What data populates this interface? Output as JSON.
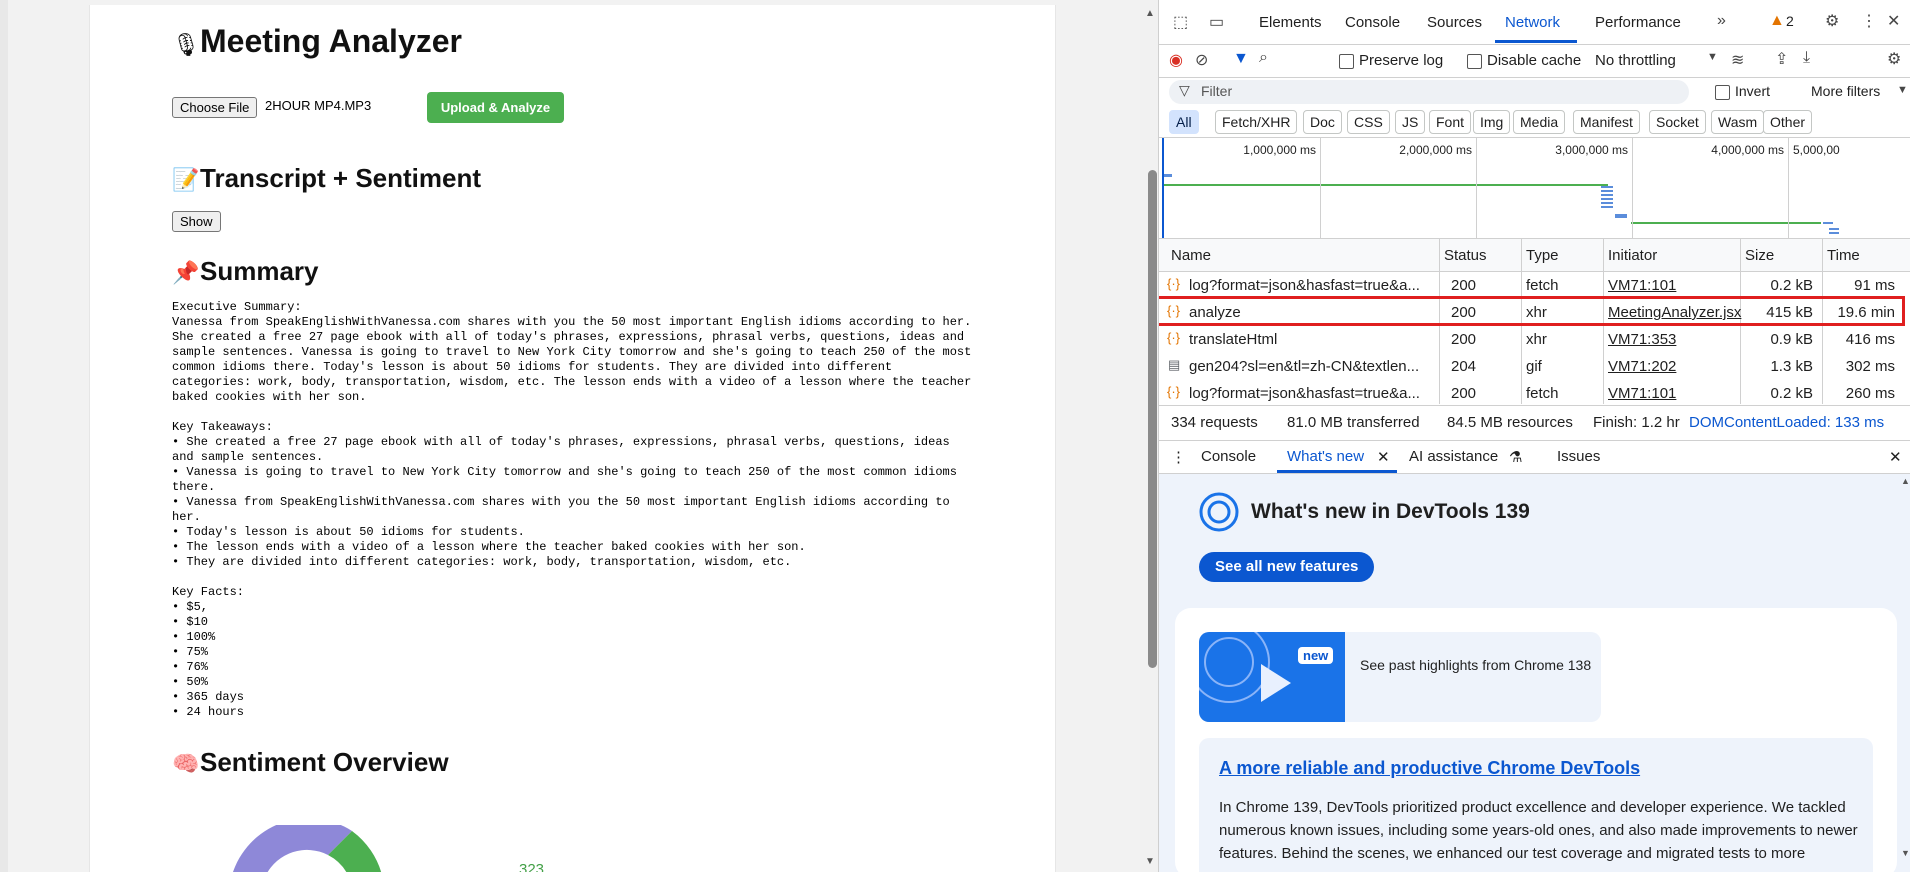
{
  "app": {
    "title": "Meeting Analyzer",
    "title_emoji": "🎙",
    "choose_file_label": "Choose File",
    "file_name": "2HOUR MP4.MP3",
    "upload_button": "Upload & Analyze",
    "transcript_heading": "Transcript + Sentiment",
    "transcript_emoji": "📝",
    "show_button": "Show",
    "summary_heading": "Summary",
    "summary_emoji": "📌",
    "summary_text": "Executive Summary:\nVanessa from SpeakEnglishWithVanessa.com shares with you the 50 most important English idioms according to her.\nShe created a free 27 page ebook with all of today's phrases, expressions, phrasal verbs, questions, ideas and\nsample sentences. Vanessa is going to travel to New York City tomorrow and she's going to teach 250 of the most\ncommon idioms there. Today's lesson is about 50 idioms for students. They are divided into different\ncategories: work, body, transportation, wisdom, etc. The lesson ends with a video of a lesson where the teacher\nbaked cookies with her son.\n\nKey Takeaways:\n• She created a free 27 page ebook with all of today's phrases, expressions, phrasal verbs, questions, ideas\nand sample sentences.\n• Vanessa is going to travel to New York City tomorrow and she's going to teach 250 of the most common idioms\nthere.\n• Vanessa from SpeakEnglishWithVanessa.com shares with you the 50 most important English idioms according to\nher.\n• Today's lesson is about 50 idioms for students.\n• The lesson ends with a video of a lesson where the teacher baked cookies with her son.\n• They are divided into different categories: work, body, transportation, wisdom, etc.\n\nKey Facts:\n• $5,\n• $10\n• 100%\n• 75%\n• 76%\n• 50%\n• 365 days\n• 24 hours",
    "sentiment_heading": "Sentiment Overview",
    "sentiment_emoji": "🧠",
    "donut_label": "323",
    "colors": {
      "upload": "#4caf50",
      "donut_main": "#8e88d8",
      "donut_positive": "#4caf50"
    }
  },
  "devtools": {
    "tabs": [
      "Elements",
      "Console",
      "Sources",
      "Network",
      "Performance"
    ],
    "active_tab": "Network",
    "warning_count": "2",
    "toolbar": {
      "preserve_log": "Preserve log",
      "disable_cache": "Disable cache",
      "throttling": "No throttling"
    },
    "filter": {
      "placeholder": "Filter",
      "invert": "Invert",
      "more_filters": "More filters"
    },
    "type_chips": [
      "All",
      "Fetch/XHR",
      "Doc",
      "CSS",
      "JS",
      "Font",
      "Img",
      "Media",
      "Manifest",
      "Socket",
      "Wasm",
      "Other"
    ],
    "timeline_ticks": [
      "1,000,000 ms",
      "2,000,000 ms",
      "3,000,000 ms",
      "4,000,000 ms",
      "5,000,00"
    ],
    "columns": [
      "Name",
      "Status",
      "Type",
      "Initiator",
      "Size",
      "Time"
    ],
    "requests": [
      {
        "name": "log?format=json&hasfast=true&a...",
        "status": "200",
        "type": "fetch",
        "initiator": "VM71:101",
        "size": "0.2 kB",
        "time": "91 ms"
      },
      {
        "name": "analyze",
        "status": "200",
        "type": "xhr",
        "initiator": "MeetingAnalyzer.jsx",
        "size": "415 kB",
        "time": "19.6 min"
      },
      {
        "name": "translateHtml",
        "status": "200",
        "type": "xhr",
        "initiator": "VM71:353",
        "size": "0.9 kB",
        "time": "416 ms"
      },
      {
        "name": "gen204?sl=en&tl=zh-CN&textlen...",
        "status": "204",
        "type": "gif",
        "initiator": "VM71:202",
        "size": "1.3 kB",
        "time": "302 ms"
      },
      {
        "name": "log?format=json&hasfast=true&a...",
        "status": "200",
        "type": "fetch",
        "initiator": "VM71:101",
        "size": "0.2 kB",
        "time": "260 ms"
      }
    ],
    "summary": {
      "requests": "334 requests",
      "transferred": "81.0 MB transferred",
      "resources": "84.5 MB resources",
      "finish": "Finish: 1.2 hr",
      "dcl": "DOMContentLoaded: 133 ms"
    },
    "drawer_tabs": [
      "Console",
      "What's new",
      "AI assistance",
      "Issues"
    ],
    "whats_new": {
      "title": "What's new in DevTools 139",
      "button": "See all new features",
      "badge": "new",
      "highlight": "See past highlights from Chrome 138",
      "article_title": "A more reliable and productive Chrome DevTools",
      "article_body": "In Chrome 139, DevTools prioritized product excellence and developer experience. We tackled numerous known issues, including some years-old ones, and also made improvements to newer features. Behind the scenes, we enhanced our test coverage and migrated tests to more"
    }
  }
}
